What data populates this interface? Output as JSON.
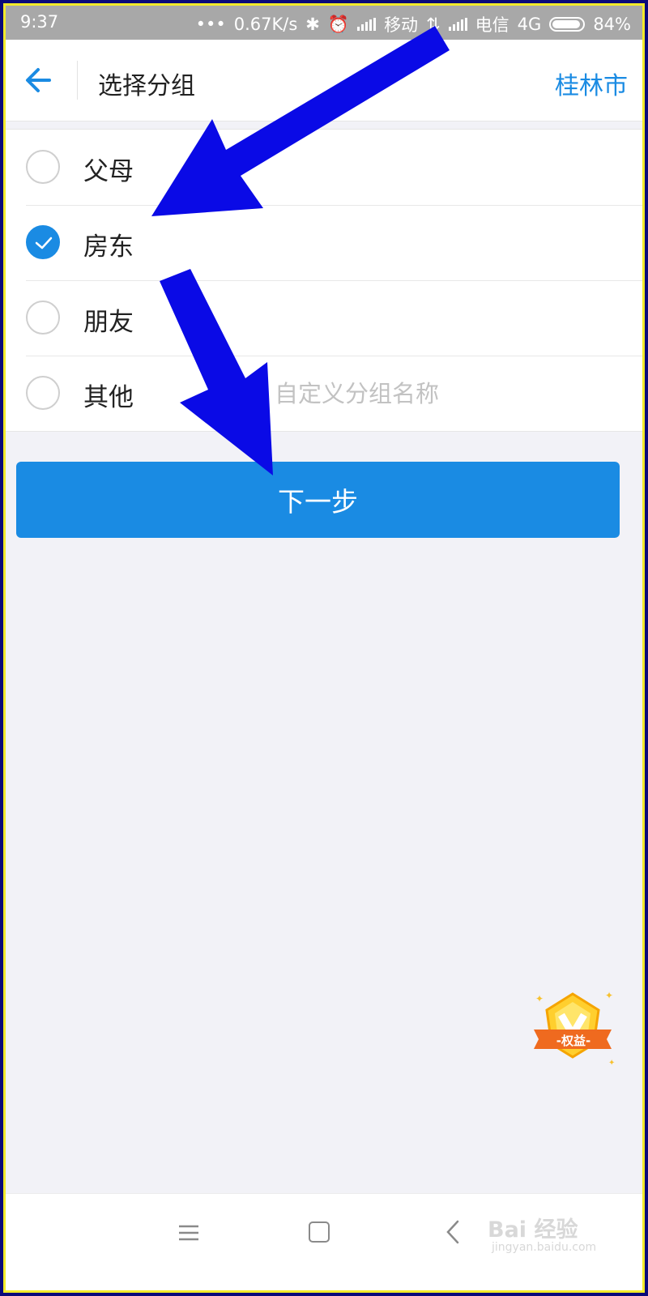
{
  "status_bar": {
    "time": "9:37",
    "dots": "•••",
    "net_speed": "0.67K/s",
    "carrier1": "移动",
    "carrier2": "电信",
    "network": "4G",
    "battery": "84%"
  },
  "header": {
    "title": "选择分组",
    "city": "桂林市"
  },
  "groups": {
    "items": [
      {
        "label": "父母",
        "checked": false
      },
      {
        "label": "房东",
        "checked": true
      },
      {
        "label": "朋友",
        "checked": false
      },
      {
        "label": "其他",
        "checked": false
      }
    ],
    "custom_placeholder": "自定义分组名称"
  },
  "next_button": "下一步",
  "badge": "-权益-",
  "watermark": {
    "brand": "Bai 经验",
    "url": "jingyan.baidu.com"
  },
  "colors": {
    "accent": "#1a8be3",
    "annotation_arrow": "#0a0ae6"
  }
}
